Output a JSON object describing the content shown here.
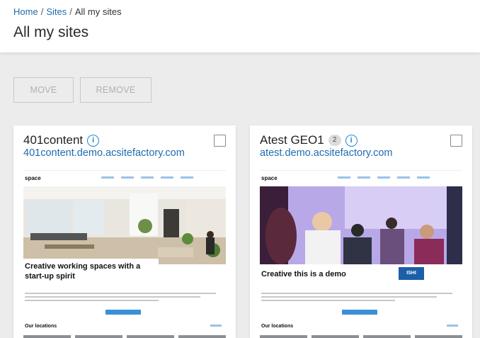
{
  "breadcrumb": {
    "home": "Home",
    "sites": "Sites",
    "current": "All my sites",
    "separator": "/"
  },
  "page_title": "All my sites",
  "toolbar": {
    "move_label": "MOVE",
    "remove_label": "REMOVE"
  },
  "sites": [
    {
      "name": "401content",
      "url": "401content.demo.acsitefactory.com",
      "badge": "",
      "selected": false,
      "preview": {
        "logo": "space",
        "headline": "Creative working spaces with a start-up spirit",
        "section": "Our locations"
      }
    },
    {
      "name": "Atest GEO1",
      "url": "atest.demo.acsitefactory.com",
      "badge": "2",
      "selected": false,
      "preview": {
        "logo": "space",
        "headline": "Creative this is a demo",
        "section": "Our locations",
        "overlay_label": "ISHI"
      }
    }
  ],
  "colors": {
    "link": "#1f6bb0",
    "info": "#1f8ad0",
    "page_bg": "#ececec"
  },
  "icons": {
    "info": "info-circle-icon",
    "checkbox": "checkbox-icon"
  }
}
